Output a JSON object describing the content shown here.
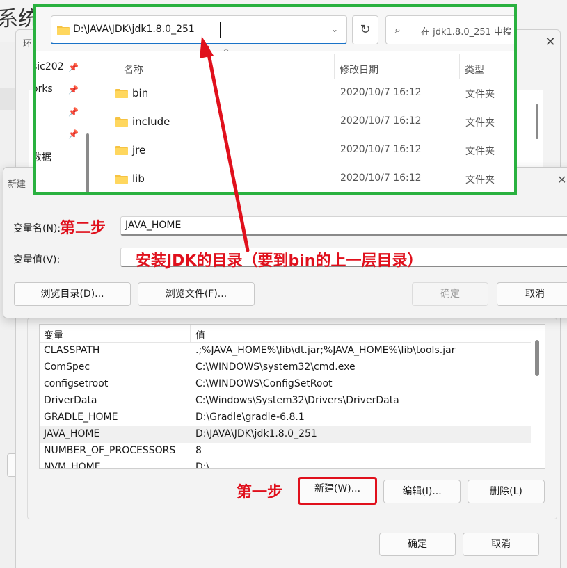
{
  "background": {
    "title_fragment": "系统",
    "env_window_title_fragment": "环"
  },
  "explorer": {
    "address": "D:\\JAVA\\JDK\\jdk1.8.0_251",
    "search_placeholder": "在 jdk1.8.0_251 中搜",
    "nav_items": [
      "sic202",
      "orks",
      "",
      "",
      "数据"
    ],
    "columns": {
      "name": "名称",
      "modified": "修改日期",
      "type": "类型"
    },
    "files": [
      {
        "name": "bin",
        "modified": "2020/10/7 16:12",
        "type": "文件夹"
      },
      {
        "name": "include",
        "modified": "2020/10/7 16:12",
        "type": "文件夹"
      },
      {
        "name": "jre",
        "modified": "2020/10/7 16:12",
        "type": "文件夹"
      },
      {
        "name": "lib",
        "modified": "2020/10/7 16:12",
        "type": "文件夹"
      }
    ]
  },
  "dialog": {
    "title": "新建",
    "name_label": "变量名(N):",
    "name_value": "JAVA_HOME",
    "value_label": "变量值(V):",
    "value_value": "",
    "browse_dir": "浏览目录(D)...",
    "browse_file": "浏览文件(F)...",
    "ok": "确定",
    "cancel": "取消"
  },
  "system_variables": {
    "col_variable": "变量",
    "col_value": "值",
    "rows": [
      {
        "name": "CLASSPATH",
        "value": ".;%JAVA_HOME%\\lib\\dt.jar;%JAVA_HOME%\\lib\\tools.jar"
      },
      {
        "name": "ComSpec",
        "value": "C:\\WINDOWS\\system32\\cmd.exe"
      },
      {
        "name": "configsetroot",
        "value": "C:\\WINDOWS\\ConfigSetRoot"
      },
      {
        "name": "DriverData",
        "value": "C:\\Windows\\System32\\Drivers\\DriverData"
      },
      {
        "name": "GRADLE_HOME",
        "value": "D:\\Gradle\\gradle-6.8.1"
      },
      {
        "name": "JAVA_HOME",
        "value": "D:\\JAVA\\JDK\\jdk1.8.0_251",
        "selected": true
      },
      {
        "name": "NUMBER_OF_PROCESSORS",
        "value": "8"
      },
      {
        "name": "NVM_HOME",
        "value": "D:\\"
      }
    ],
    "buttons": {
      "new": "新建(W)...",
      "edit": "编辑(I)...",
      "delete": "删除(L)"
    }
  },
  "window_buttons": {
    "ok": "确定",
    "cancel": "取消"
  },
  "annotations": {
    "step1": "第一步",
    "step2": "第二步",
    "hint": "安装JDK的目录（要到bin的上一层目录）"
  },
  "colors": {
    "annotation_red": "#e0101c",
    "highlight_green": "#29b13f",
    "folder_yellow": "#f6c343"
  }
}
